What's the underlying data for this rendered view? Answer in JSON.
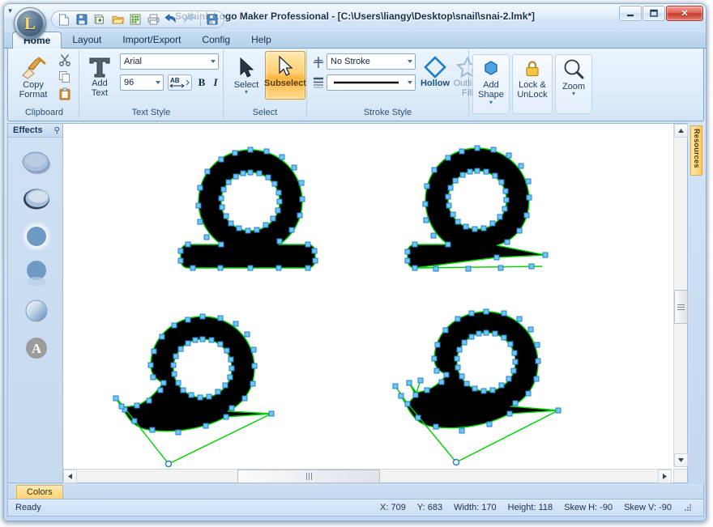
{
  "window": {
    "title": "Sothink Logo Maker Professional - [C:\\Users\\liangy\\Desktop\\snail\\snai-2.lmk*]",
    "minimize_label": "–",
    "maximize_label": "❐",
    "close_label": "✕",
    "orb_glyph": "L"
  },
  "quick_access": {
    "items": [
      {
        "name": "new-file-icon",
        "tooltip": "New"
      },
      {
        "name": "save-icon",
        "tooltip": "Save"
      },
      {
        "name": "new-window-icon",
        "tooltip": "New Window"
      },
      {
        "name": "open-folder-icon",
        "tooltip": "Open"
      },
      {
        "name": "export-image-icon",
        "tooltip": "Export"
      },
      {
        "name": "print-icon",
        "tooltip": "Print"
      },
      {
        "name": "undo-icon",
        "tooltip": "Undo"
      },
      {
        "name": "redo-icon",
        "tooltip": "Redo"
      },
      {
        "name": "save-as-icon",
        "tooltip": "Save As"
      }
    ],
    "more_label": "▾"
  },
  "tabs": [
    {
      "label": "Home",
      "active": true
    },
    {
      "label": "Layout",
      "active": false
    },
    {
      "label": "Import/Export",
      "active": false
    },
    {
      "label": "Config",
      "active": false
    },
    {
      "label": "Help",
      "active": false
    }
  ],
  "ribbon": {
    "groups": [
      {
        "label": "Clipboard",
        "copy_format_line1": "Copy",
        "copy_format_line2": "Format",
        "cut_label": "Cut",
        "copy_label": "Copy",
        "paste_label": "Paste"
      },
      {
        "label": "Text Style",
        "add_text_line1": "Add",
        "add_text_line2": "Text",
        "font_family_value": "Arial",
        "font_size_value": "96",
        "letter_spacing_label": "AB",
        "bold_label": "B",
        "italic_label": "I"
      },
      {
        "label": "Select",
        "select_label": "Select",
        "subselect_label": "Subselect"
      },
      {
        "label": "Stroke Style",
        "stroke_value": "No Stroke",
        "stroke_width_value": "",
        "hollow_label": "Hollow",
        "outline_fill_line1": "Outline",
        "outline_fill_line2": "Fill"
      },
      {
        "label": "",
        "add_shape_line1": "Add",
        "add_shape_line2": "Shape",
        "lock_line1": "Lock &",
        "lock_line2": "UnLock",
        "zoom_label": "Zoom"
      }
    ]
  },
  "effects_panel": {
    "title": "Effects",
    "pin_glyph": "⟳",
    "items": [
      {
        "name": "effect-drop-shadow",
        "label": "Drop Shadow"
      },
      {
        "name": "effect-inner-shadow",
        "label": "Inner Shadow"
      },
      {
        "name": "effect-glow",
        "label": "Glow"
      },
      {
        "name": "effect-reflection",
        "label": "Reflection"
      },
      {
        "name": "effect-gradient-bevel",
        "label": "Gradient Bevel"
      },
      {
        "name": "effect-text-mask",
        "label": "Text Mask"
      }
    ]
  },
  "resources_tab": {
    "label": "Resources"
  },
  "canvas": {
    "background": "#ffffff",
    "path_stroke_color": "#00d000",
    "anchor_color": "#55b4f5",
    "shape_fill": "#000000",
    "shapes": [
      {
        "name": "snail-logo-top-left",
        "variant": "no-tail"
      },
      {
        "name": "snail-logo-top-right",
        "variant": "short-tail"
      },
      {
        "name": "snail-logo-bottom-left",
        "variant": "curved-body"
      },
      {
        "name": "snail-logo-bottom-right",
        "variant": "curved-body-antenna"
      }
    ]
  },
  "scrollbars": {
    "up_glyph": "▲",
    "down_glyph": "▼",
    "left_glyph": "◀",
    "right_glyph": "▶",
    "v_grip": "≡",
    "h_grip": "|||"
  },
  "bottom_tabs": [
    {
      "label": "Colors",
      "active": true
    }
  ],
  "statusbar": {
    "message": "Ready",
    "metrics": [
      {
        "label": "X:",
        "value": "709"
      },
      {
        "label": "Y:",
        "value": "683"
      },
      {
        "label": "Width:",
        "value": "170"
      },
      {
        "label": "Height:",
        "value": "118"
      },
      {
        "label": "Skew H:",
        "value": "-90"
      },
      {
        "label": "Skew V:",
        "value": "-90"
      }
    ]
  },
  "colors": {
    "accent": "#f6c85e",
    "frame": "#8faecd",
    "ribbon_bg": "#e0edfa",
    "path_green": "#00d000",
    "anchor_blue": "#55b4f5",
    "title_text": "#16314d"
  }
}
